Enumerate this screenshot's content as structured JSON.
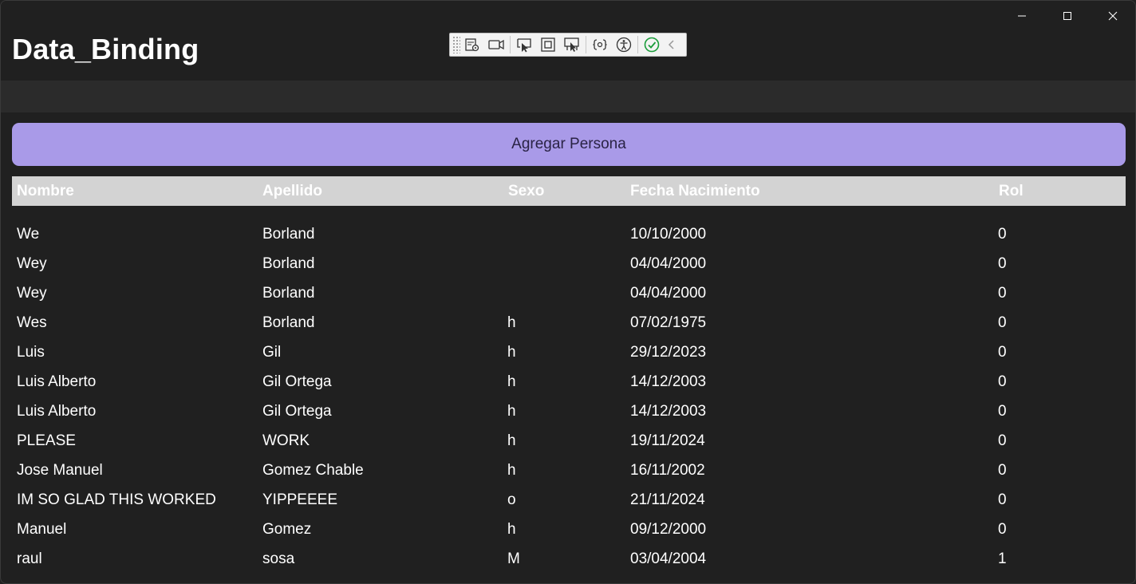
{
  "window": {
    "title": "Data_Binding",
    "caption_buttons": {
      "minimize_icon": "minimize-icon",
      "maximize_icon": "maximize-icon",
      "close_icon": "close-icon"
    }
  },
  "dev_toolbar": {
    "icons": [
      "live-visual-tree-icon",
      "record-icon",
      "select-element-icon",
      "display-layout-adorners-icon",
      "track-focus-icon",
      "binding-failures-icon",
      "accessibility-icon",
      "status-ok-icon",
      "collapse-chevron-icon"
    ]
  },
  "actions": {
    "add_person_label": "Agregar Persona"
  },
  "table": {
    "columns": [
      "Nombre",
      "Apellido",
      "Sexo",
      "Fecha Nacimiento",
      "Rol"
    ],
    "rows": [
      {
        "nombre": "We",
        "apellido": "Borland",
        "sexo": "",
        "fecha": "10/10/2000",
        "rol": "0"
      },
      {
        "nombre": "Wey",
        "apellido": "Borland",
        "sexo": "",
        "fecha": "04/04/2000",
        "rol": "0"
      },
      {
        "nombre": "Wey",
        "apellido": "Borland",
        "sexo": "",
        "fecha": "04/04/2000",
        "rol": "0"
      },
      {
        "nombre": "Wes",
        "apellido": "Borland",
        "sexo": "h",
        "fecha": "07/02/1975",
        "rol": "0"
      },
      {
        "nombre": "Luis",
        "apellido": "Gil",
        "sexo": "h",
        "fecha": "29/12/2023",
        "rol": "0"
      },
      {
        "nombre": "Luis Alberto",
        "apellido": "Gil Ortega",
        "sexo": "h",
        "fecha": "14/12/2003",
        "rol": "0"
      },
      {
        "nombre": "Luis Alberto",
        "apellido": "Gil Ortega",
        "sexo": "h",
        "fecha": "14/12/2003",
        "rol": "0"
      },
      {
        "nombre": "PLEASE",
        "apellido": "WORK",
        "sexo": "h",
        "fecha": "19/11/2024",
        "rol": "0"
      },
      {
        "nombre": "Jose Manuel",
        "apellido": "Gomez Chable",
        "sexo": "h",
        "fecha": "16/11/2002",
        "rol": "0"
      },
      {
        "nombre": "IM SO GLAD THIS WORKED",
        "apellido": "YIPPEEEE",
        "sexo": "o",
        "fecha": "21/11/2024",
        "rol": "0"
      },
      {
        "nombre": "Manuel",
        "apellido": "Gomez",
        "sexo": "h",
        "fecha": "09/12/2000",
        "rol": "0"
      },
      {
        "nombre": "raul",
        "apellido": "sosa",
        "sexo": "M",
        "fecha": "03/04/2004",
        "rol": "1"
      }
    ]
  },
  "colors": {
    "background": "#202020",
    "accent_button": "#a99ae8",
    "header_bg": "#d3d3d3",
    "check_green": "#1a9c3a"
  }
}
